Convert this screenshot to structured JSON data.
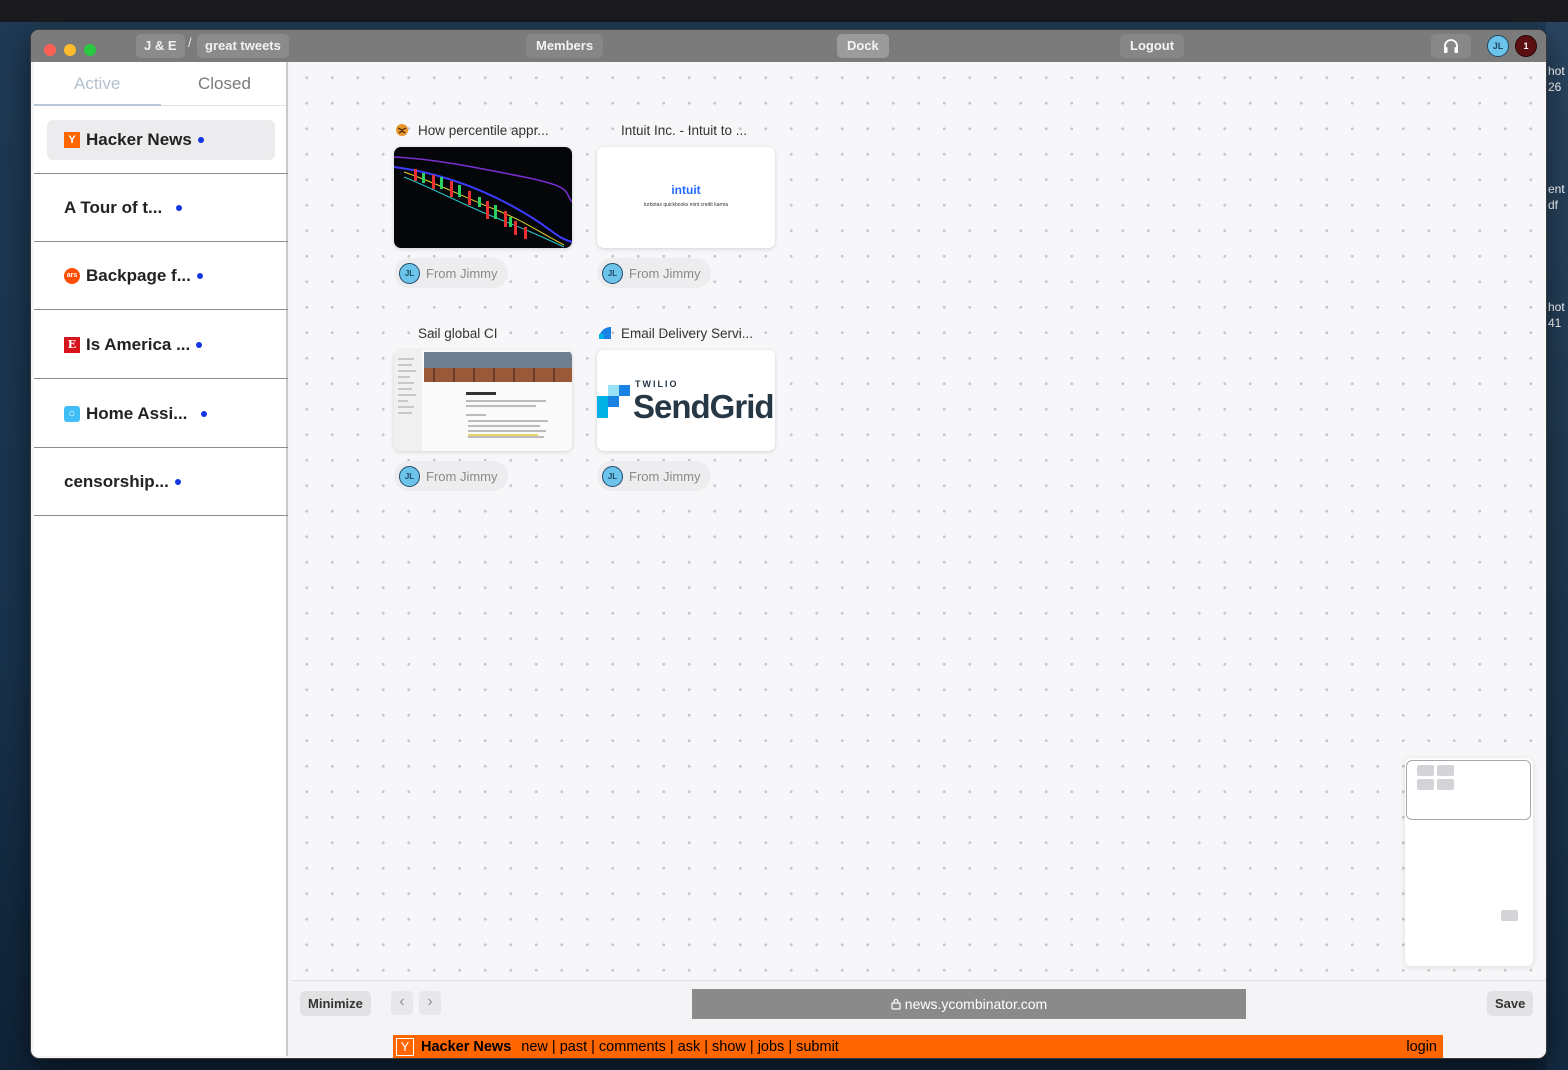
{
  "topbar": {
    "crumb_1": "J & E",
    "crumb_sep": "/",
    "crumb_2": "great tweets",
    "members": "Members",
    "dock": "Dock",
    "logout": "Logout",
    "user_initials": "JL",
    "notification_count": "1"
  },
  "sidebar": {
    "tab_active": "Active",
    "tab_closed": "Closed",
    "items": [
      {
        "label": "Hacker News",
        "icon": "hacker-news-icon",
        "selected": true
      },
      {
        "label": "A Tour of t...",
        "icon": "",
        "selected": false
      },
      {
        "label": "Backpage f...",
        "icon": "ars-technica-icon",
        "selected": false
      },
      {
        "label": "Is America ...",
        "icon": "economist-icon",
        "selected": false
      },
      {
        "label": "Home Assi...",
        "icon": "home-assistant-icon",
        "selected": false
      },
      {
        "label": "censorship...",
        "icon": "",
        "selected": false
      }
    ]
  },
  "cards": [
    {
      "title": "How percentile appr...",
      "from": "From Jimmy",
      "initials": "JL"
    },
    {
      "title": "Intuit Inc. - Intuit to ...",
      "from": "From Jimmy",
      "initials": "JL",
      "thumb_logo": "intuit",
      "thumb_brands": "turbotax  quickbooks  mint  credit karma"
    },
    {
      "title": "Sail global CI",
      "from": "From Jimmy",
      "initials": "JL"
    },
    {
      "title": "Email Delivery Servi...",
      "from": "From Jimmy",
      "initials": "JL",
      "thumb_small": "TWILIO",
      "thumb_big": "SendGrid"
    }
  ],
  "bottombar": {
    "minimize": "Minimize",
    "back": "‹",
    "forward": "›",
    "url": "news.ycombinator.com",
    "save": "Save"
  },
  "hn": {
    "logo": "Y",
    "brand": "Hacker News",
    "links": "new | past | comments | ask | show | jobs | submit",
    "login": "login"
  },
  "desktop_edge": [
    "hot",
    "26",
    "ent",
    "df",
    "hot",
    "41"
  ],
  "colors": {
    "hn_orange": "#ff6600",
    "unread_dot": "#1335e8",
    "topbar": "#7b7b7b"
  }
}
